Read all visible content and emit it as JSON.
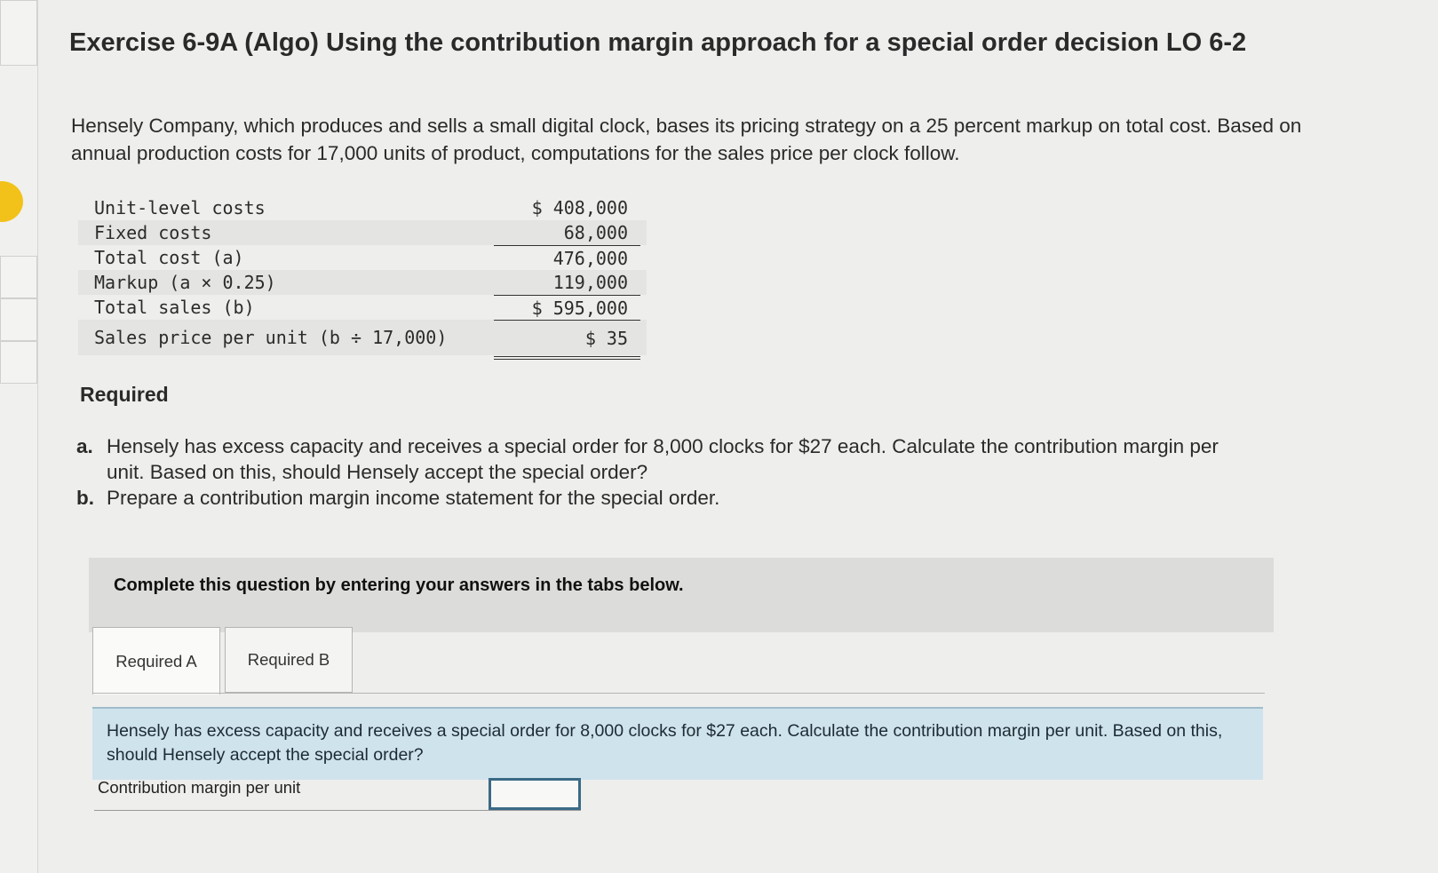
{
  "exercise": {
    "title": "Exercise 6-9A (Algo) Using the contribution margin approach for a special order decision LO 6-2",
    "intro": "Hensely Company, which produces and sells a small digital clock, bases its pricing strategy on a 25 percent markup on total cost. Based on annual production costs for 17,000 units of product, computations for the sales price per clock follow."
  },
  "cost_table": {
    "rows": [
      {
        "label": "Unit-level costs",
        "value": "$ 408,000"
      },
      {
        "label": "Fixed costs",
        "value": "68,000"
      },
      {
        "label": "Total cost (a)",
        "value": "476,000"
      },
      {
        "label": "Markup (a × 0.25)",
        "value": "119,000"
      },
      {
        "label": "Total sales (b)",
        "value": "$ 595,000"
      },
      {
        "label": "Sales price per unit (b ÷ 17,000)",
        "value": "$ 35"
      }
    ]
  },
  "required": {
    "heading": "Required",
    "items": [
      {
        "letter": "a.",
        "text": "Hensely has excess capacity and receives a special order for 8,000 clocks for $27 each. Calculate the contribution margin per unit. Based on this, should Hensely accept the special order?"
      },
      {
        "letter": "b.",
        "text": "Prepare a contribution margin income statement for the special order."
      }
    ]
  },
  "instructions": "Complete this question by entering your answers in the tabs below.",
  "tabs": [
    {
      "label": "Required A",
      "active": true
    },
    {
      "label": "Required B",
      "active": false
    }
  ],
  "question": "Hensely has excess capacity and receives a special order for 8,000 clocks for $27 each. Calculate the contribution margin per unit. Based on this, should Hensely accept the special order?",
  "answer": {
    "label": "Contribution margin per unit",
    "value": ""
  },
  "colors": {
    "marker": "#f2c21a",
    "question_bg": "#cfe3ed",
    "instruction_bg": "#dcdcda"
  }
}
